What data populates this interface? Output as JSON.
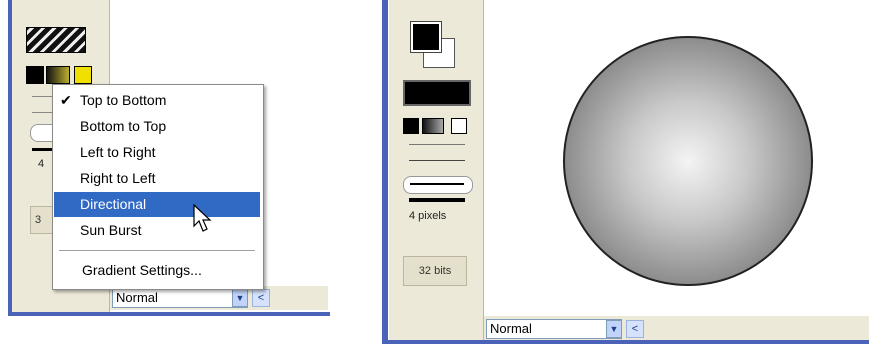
{
  "left_window": {
    "gradient_menu": {
      "items": [
        {
          "label": "Top to Bottom",
          "checked": true
        },
        {
          "label": "Bottom to Top",
          "checked": false
        },
        {
          "label": "Left to Right",
          "checked": false
        },
        {
          "label": "Right to Left",
          "checked": false
        },
        {
          "label": "Directional",
          "checked": false
        },
        {
          "label": "Sun Burst",
          "checked": false
        }
      ],
      "selected_item": "Directional",
      "check_glyph": "✔",
      "settings_label": "Gradient Settings..."
    },
    "toolbar": {
      "stroke_size_partial": "4",
      "bits_partial": "3"
    },
    "statusbar": {
      "blend_mode": "Normal"
    }
  },
  "right_window": {
    "toolbar": {
      "stroke_size": "4 pixels",
      "bit_depth": "32 bits"
    },
    "statusbar": {
      "blend_mode": "Normal"
    }
  },
  "icons": {
    "select_arrow": "▼",
    "scroll_left": "<"
  },
  "colors": {
    "frame_blue": "#4a62b8",
    "menu_highlight": "#316ac5",
    "toolbar_bg": "#ece9d8",
    "yellow_swatch": "#f0e000"
  }
}
